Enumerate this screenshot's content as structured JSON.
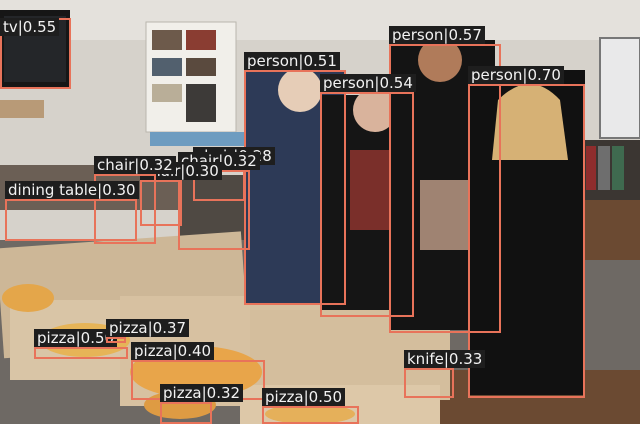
{
  "detections": [
    {
      "label": "tv|0.55"
    },
    {
      "label": "person|0.51"
    },
    {
      "label": "person|0.57"
    },
    {
      "label": "person|0.54"
    },
    {
      "label": "person|0.70"
    },
    {
      "label": "chair|0.32"
    },
    {
      "label": "chair|0.30"
    },
    {
      "label": "chair|0.28"
    },
    {
      "label": "chair|0.32"
    },
    {
      "label": "dining table|0.30"
    },
    {
      "label": "pizza|0.50"
    },
    {
      "label": "pizza|0.37"
    },
    {
      "label": "pizza|0.40"
    },
    {
      "label": "pizza|0.32"
    },
    {
      "label": "pizza|0.50"
    },
    {
      "label": "knife|0.33"
    }
  ],
  "colors": {
    "box": "#e8735a",
    "label_bg": "#1e1e1e",
    "label_text": "#f2f2f2"
  }
}
